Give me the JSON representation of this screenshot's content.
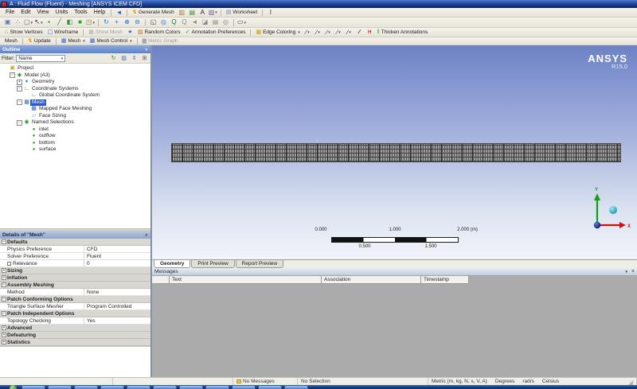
{
  "window": {
    "title": "A : Fluid Flow (Fluent) - Meshing [ANSYS ICEM CFD]"
  },
  "menu": {
    "items": [
      "File",
      "Edit",
      "View",
      "Units",
      "Tools",
      "Help"
    ]
  },
  "toolbar1": {
    "left_icons": [
      {
        "name": "insert-pointer-icon",
        "glyph": "◄",
        "color": "#2f66d0"
      }
    ],
    "generate_mesh": "Generate Mesh",
    "mid_icons": [
      {
        "name": "figure-icon",
        "glyph": "▥",
        "color": "#b07820"
      },
      {
        "name": "new-report-icon",
        "glyph": "▤",
        "color": "#3a8a3a"
      },
      {
        "name": "label-icon",
        "glyph": "A",
        "color": "#222222"
      },
      {
        "name": "image-capture-dropdown",
        "glyph": "▧",
        "color": "#7a5aa0",
        "dd": true
      }
    ],
    "worksheet": "Worksheet",
    "right_icons": [
      {
        "name": "ibeam-cursor-icon",
        "glyph": "I",
        "color": "#333333"
      }
    ]
  },
  "toolbar2": {
    "icons": [
      {
        "name": "pick-label-icon",
        "glyph": "▣",
        "color": "#5a77c0"
      },
      {
        "name": "pick-coordinates-icon",
        "glyph": "∴",
        "color": "#5a77c0"
      },
      {
        "name": "select-shape-dropdown",
        "glyph": "▢",
        "color": "#666666",
        "dd": true
      },
      {
        "name": "select-mode-dropdown",
        "glyph": "↖",
        "color": "#222222",
        "dd": true
      },
      {
        "name": "vertex-filter-icon",
        "glyph": "▪",
        "color": "#2e8b2e"
      },
      {
        "name": "edge-filter-icon",
        "glyph": "╱",
        "color": "#2e8b2e"
      },
      {
        "name": "face-filter-icon",
        "glyph": "◧",
        "color": "#2e8b2e"
      },
      {
        "name": "body-filter-icon",
        "glyph": "■",
        "color": "#1fb11f"
      },
      {
        "name": "extend-selection-dropdown",
        "glyph": "◳",
        "color": "#8a6a2a",
        "dd": true
      },
      {
        "cls": "sep"
      },
      {
        "name": "rotate-icon",
        "glyph": "↻",
        "color": "#1f6fd0"
      },
      {
        "name": "pan-icon",
        "glyph": "+",
        "color": "#1f6fd0"
      },
      {
        "name": "zoom-in-icon",
        "glyph": "⊕",
        "color": "#1f6fd0"
      },
      {
        "name": "zoom-out-icon",
        "glyph": "⊖",
        "color": "#1f6fd0"
      },
      {
        "cls": "sep"
      },
      {
        "name": "zoom-box-icon",
        "glyph": "◱",
        "color": "#444444"
      },
      {
        "name": "fit-view-icon",
        "glyph": "◎",
        "color": "#1f6fd0"
      },
      {
        "name": "magnifier-icon",
        "glyph": "Q",
        "color": "#0a7d2c"
      },
      {
        "name": "magnifier-window-icon",
        "glyph": "Q",
        "color": "#888888"
      },
      {
        "name": "previous-view-icon",
        "glyph": "◄",
        "color": "#888888"
      },
      {
        "name": "iso-view-icon",
        "glyph": "◪",
        "color": "#888888"
      },
      {
        "name": "tags-icon",
        "glyph": "▤",
        "color": "#888888"
      },
      {
        "name": "look-at-icon",
        "glyph": "◎",
        "color": "#888888"
      },
      {
        "cls": "sep"
      },
      {
        "name": "viewports-dropdown",
        "glyph": "▭",
        "color": "#333333",
        "dd": true
      }
    ]
  },
  "toolbar3": {
    "show_vertices": "Show Vertices",
    "wireframe": "Wireframe",
    "show_mesh": "Show Mesh",
    "random_colors": "Random Colors",
    "annotation_preferences": "Annotation Preferences",
    "edge_coloring": "Edge Coloring",
    "thicken_annotations": "Thicken Annotations",
    "pens": [
      {
        "name": "edge-direction-dropdown",
        "glyph": "∕",
        "color": "#333333",
        "dd": true
      },
      {
        "name": "edge-direction-dropdown",
        "glyph": "∕",
        "color": "#333333",
        "dd": true
      },
      {
        "name": "edge-direction-dropdown",
        "glyph": "∕",
        "color": "#333333",
        "dd": true
      },
      {
        "name": "edge-direction-dropdown",
        "glyph": "∕",
        "color": "#333333",
        "dd": true
      },
      {
        "name": "edge-direction-dropdown",
        "glyph": "∕",
        "color": "#333333",
        "dd": true
      }
    ]
  },
  "toolbar4": {
    "mesh": "Mesh",
    "update": "Update",
    "mesh_menu": "Mesh",
    "mesh_control": "Mesh Control",
    "metric_graph": "Metric Graph"
  },
  "outline": {
    "title": "Outline",
    "filter_label": "Filter:",
    "filter_value": "Name",
    "filter_icons": [
      {
        "name": "refresh-icon",
        "glyph": "↻",
        "color": "#2a8a2a"
      },
      {
        "name": "flat-tree-icon",
        "glyph": "▨",
        "color": "#4a6fae"
      },
      {
        "name": "expand-collapse-icon",
        "glyph": "⇕",
        "color": "#4a6fae"
      },
      {
        "name": "show-all-icon",
        "glyph": "⊞",
        "color": "#555555"
      }
    ],
    "tree": [
      {
        "name": "tree-item-project",
        "label": "Project",
        "icon": "project",
        "depth": 0
      },
      {
        "name": "tree-item-model",
        "label": "Model (A3)",
        "icon": "model",
        "depth": 1,
        "exp": "−"
      },
      {
        "name": "tree-item-geometry",
        "label": "Geometry",
        "icon": "geometry",
        "depth": 2,
        "exp": "+"
      },
      {
        "name": "tree-item-coordinate-systems",
        "label": "Coordinate Systems",
        "icon": "csys",
        "depth": 2,
        "exp": "−"
      },
      {
        "name": "tree-item-global-coordinate-system",
        "label": "Global Coordinate System",
        "icon": "csys",
        "depth": 3
      },
      {
        "name": "tree-item-mesh",
        "label": "Mesh",
        "icon": "mesh",
        "depth": 2,
        "exp": "−",
        "cls": "selected"
      },
      {
        "name": "tree-item-mapped-face-meshing",
        "label": "Mapped Face Meshing",
        "icon": "mapped",
        "depth": 3
      },
      {
        "name": "tree-item-face-sizing",
        "label": "Face Sizing",
        "icon": "sizing",
        "depth": 3
      },
      {
        "name": "tree-item-named-selections",
        "label": "Named Selections",
        "icon": "named",
        "depth": 2,
        "exp": "−"
      },
      {
        "name": "tree-item-inlet",
        "label": "inlet",
        "icon": "ns",
        "depth": 3
      },
      {
        "name": "tree-item-outflow",
        "label": "outflow",
        "icon": "ns",
        "depth": 3
      },
      {
        "name": "tree-item-bottom",
        "label": "bottom",
        "icon": "ns",
        "depth": 3
      },
      {
        "name": "tree-item-surface",
        "label": "surface",
        "icon": "ns",
        "depth": 3
      }
    ]
  },
  "details": {
    "title": "Details of \"Mesh\"",
    "rows": [
      {
        "cls": "hdr",
        "state": "−",
        "label": "Defaults",
        "name": "details-section-defaults"
      },
      {
        "label": "Physics Preference",
        "value": "CFD",
        "name": "details-row-physics-preference"
      },
      {
        "label": "Solver Preference",
        "value": "Fluent",
        "name": "details-row-solver-preference"
      },
      {
        "label": "Relevance",
        "value": "0",
        "checkbox": true,
        "name": "details-row-relevance"
      },
      {
        "cls": "hdr",
        "state": "+",
        "label": "Sizing",
        "name": "details-section-sizing"
      },
      {
        "cls": "hdr",
        "state": "+",
        "label": "Inflation",
        "name": "details-section-inflation"
      },
      {
        "cls": "hdr",
        "state": "−",
        "label": "Assembly Meshing",
        "name": "details-section-assembly-meshing"
      },
      {
        "label": "Method",
        "value": "None",
        "name": "details-row-method"
      },
      {
        "cls": "hdr",
        "state": "−",
        "label": "Patch Conforming Options",
        "name": "details-section-patch-conforming-options"
      },
      {
        "label": "Triangle Surface Mesher",
        "value": "Program Controlled",
        "name": "details-row-triangle-surface-mesher"
      },
      {
        "cls": "hdr",
        "state": "−",
        "label": "Patch Independent Options",
        "name": "details-section-patch-independent-options"
      },
      {
        "label": "Topology Checking",
        "value": "Yes",
        "name": "details-row-topology-checking"
      },
      {
        "cls": "hdr",
        "state": "+",
        "label": "Advanced",
        "name": "details-section-advanced"
      },
      {
        "cls": "hdr",
        "state": "+",
        "label": "Defeaturing",
        "name": "details-section-defeaturing"
      },
      {
        "cls": "hdr",
        "state": "+",
        "label": "Statistics",
        "name": "details-section-statistics"
      }
    ]
  },
  "viewport": {
    "logo": {
      "line1": "ANSYS",
      "line2": "R15.0"
    },
    "ruler": {
      "top": [
        "0.000",
        "1.000",
        "2.000 (m)"
      ],
      "bottom": [
        "0.500",
        "1.500"
      ]
    },
    "triad": {
      "x": "X",
      "y": "Y"
    }
  },
  "tabs": [
    {
      "name": "tab-geometry",
      "label": "Geometry",
      "cls": "active"
    },
    {
      "name": "tab-print-preview",
      "label": "Print Preview"
    },
    {
      "name": "tab-report-preview",
      "label": "Report Preview"
    }
  ],
  "messages": {
    "title": "Messages",
    "columns": [
      {
        "label": "",
        "cls": "c0",
        "name": "messages-col-icon"
      },
      {
        "label": "Text",
        "cls": "c1",
        "name": "messages-col-text"
      },
      {
        "label": "Association",
        "cls": "c2",
        "name": "messages-col-association"
      },
      {
        "label": "Timestamp",
        "cls": "c3",
        "name": "messages-col-timestamp"
      }
    ]
  },
  "statusbar": {
    "no_messages": "No Messages",
    "no_selection": "No Selection",
    "units": "Metric (m, kg, N, s, V, A)",
    "angle": "Degrees",
    "angular_velocity": "rad/s",
    "temperature": "Celsius"
  },
  "taskbar": {
    "button_count": 11
  },
  "colors": {
    "selection": "#2a5ad0",
    "axis_x": "#cc1111",
    "axis_y": "#11a011",
    "z_ball": "#30b8d0",
    "origin_ball": "#1133bb",
    "viewport_top": "#6d82c4",
    "mesh_fill": "#9a9a9a"
  }
}
